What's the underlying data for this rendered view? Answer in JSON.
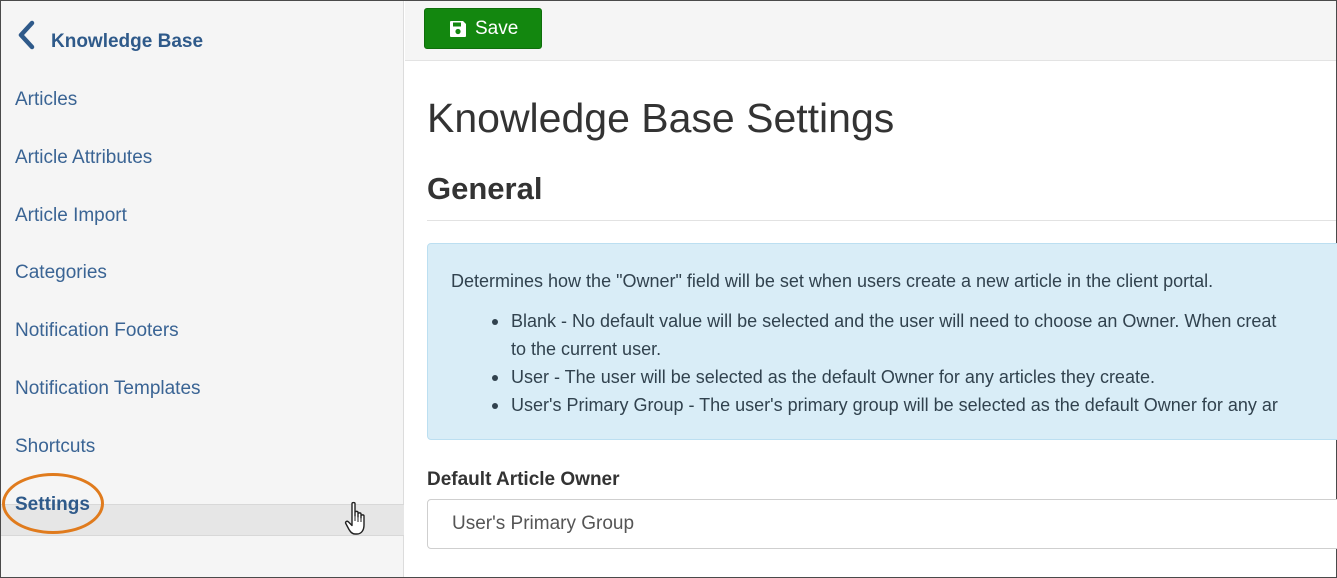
{
  "sidebar": {
    "title": "Knowledge Base",
    "back_icon": "chevron-left-icon",
    "items": [
      {
        "label": "Articles"
      },
      {
        "label": "Article Attributes"
      },
      {
        "label": "Article Import"
      },
      {
        "label": "Categories"
      },
      {
        "label": "Notification Footers"
      },
      {
        "label": "Notification Templates"
      },
      {
        "label": "Shortcuts"
      },
      {
        "label": "Settings",
        "active": true
      }
    ]
  },
  "toolbar": {
    "save_label": "Save",
    "save_icon": "floppy-disk-icon",
    "save_color": "#13870f"
  },
  "main": {
    "page_title": "Knowledge Base Settings",
    "section_title": "General",
    "info": {
      "intro": "Determines how the \"Owner\" field will be set when users create a new article in the client portal.",
      "items": [
        {
          "line1": "Blank - No default value will be selected and the user will need to choose an Owner. When creat",
          "line2": "to the current user."
        },
        {
          "line1": "User - The user will be selected as the default Owner for any articles they create."
        },
        {
          "line1": "User's Primary Group - The user's primary group will be selected as the default Owner for any ar"
        }
      ]
    },
    "default_owner": {
      "label": "Default Article Owner",
      "value": "User's Primary Group"
    }
  },
  "colors": {
    "accent_link": "#3a6494",
    "highlight_ring": "#e07b1d",
    "info_bg": "#d9edf7"
  }
}
